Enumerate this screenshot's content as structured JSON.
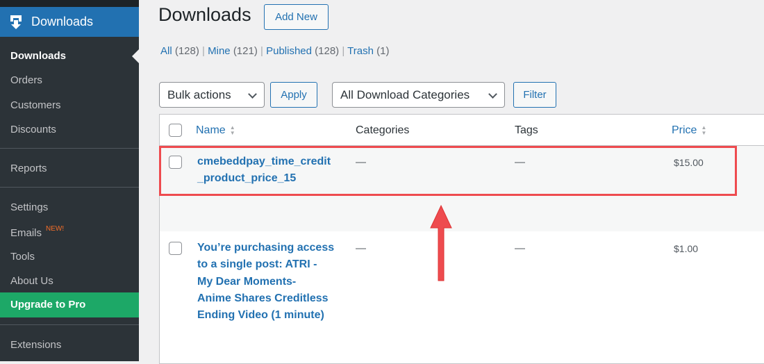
{
  "sidebar": {
    "header": {
      "label": "Downloads",
      "icon": "download-icon"
    },
    "items": [
      {
        "label": "Downloads",
        "current": true
      },
      {
        "label": "Orders"
      },
      {
        "label": "Customers"
      },
      {
        "label": "Discounts"
      },
      {
        "label": "Reports"
      },
      {
        "label": "Settings"
      },
      {
        "label": "Emails",
        "badge": "NEW!"
      },
      {
        "label": "Tools"
      },
      {
        "label": "About Us"
      },
      {
        "label": "Upgrade to Pro"
      },
      {
        "label": "Extensions"
      }
    ]
  },
  "page": {
    "title": "Downloads",
    "add_new": "Add New"
  },
  "filters": [
    {
      "label": "All",
      "count": "(128)"
    },
    {
      "label": "Mine",
      "count": "(121)"
    },
    {
      "label": "Published",
      "count": "(128)"
    },
    {
      "label": "Trash",
      "count": "(1)"
    }
  ],
  "filter_sep": "|",
  "toolbar": {
    "bulk_actions": "Bulk actions",
    "apply": "Apply",
    "category": "All Download Categories",
    "filter": "Filter"
  },
  "table": {
    "columns": [
      "Name",
      "Categories",
      "Tags",
      "Price"
    ],
    "rows": [
      {
        "name_lines": [
          "cmebeddpay_time_credit",
          "_product_price_15"
        ],
        "categories": "—",
        "tags": "—",
        "price": "$15.00"
      },
      {
        "name_lines": [
          "You’re purchasing access",
          "to a single post: ATRI -",
          "My Dear Moments-",
          "Anime Shares Creditless",
          "Ending Video (1 minute)"
        ],
        "categories": "—",
        "tags": "—",
        "price": "$1.00"
      }
    ]
  },
  "colors": {
    "accent": "#2271b1",
    "upgrade": "#1da867",
    "highlight": "#ee4b4f",
    "sidebar": "#2c3338"
  }
}
